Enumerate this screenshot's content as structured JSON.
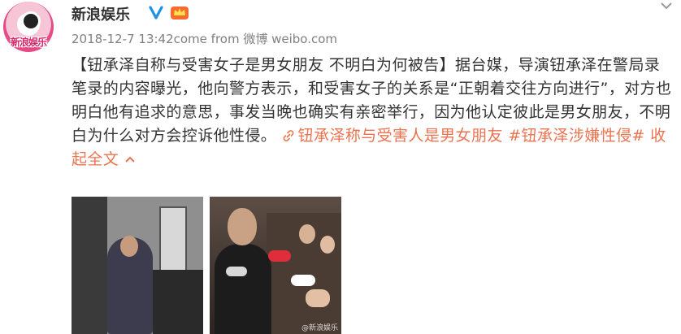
{
  "header": {
    "name": "新浪娱乐",
    "avatar_text": "新浪娱乐",
    "verified_icon": "verified-v-icon",
    "member_icon": "member-crown-icon",
    "chevron_icon": "chevron-down-icon"
  },
  "meta": {
    "date": "2018-12-7 13:42",
    "from_text": "come from 微博 weibo.com"
  },
  "post": {
    "headline": "【钮承泽自称与受害女子是男女朋友 不明白为何被告】",
    "body": "据台媒，导演钮承泽在警局录笔录的内容曝光，他向警方表示，和受害女子的关系是“正朝着交往方向进行”，对方也明白他有追求的意思，事发当晚也确实有亲密举行，因为他认定彼此是男女朋友，不明白为什么对方会控诉他性侵。",
    "link_text": "钮承泽称与受害人是男女朋友",
    "hashtag": "#钮承泽涉嫌性侵#",
    "collapse": "收起全文",
    "collapse_icon": "chevron-up-icon",
    "link_icon": "link-icon"
  },
  "photos": [
    {
      "name": "photo-1"
    },
    {
      "name": "photo-2",
      "watermark": "@新浪娱乐"
    }
  ],
  "colors": {
    "link": "#eb7350",
    "meta": "#808080",
    "text": "#333333"
  }
}
